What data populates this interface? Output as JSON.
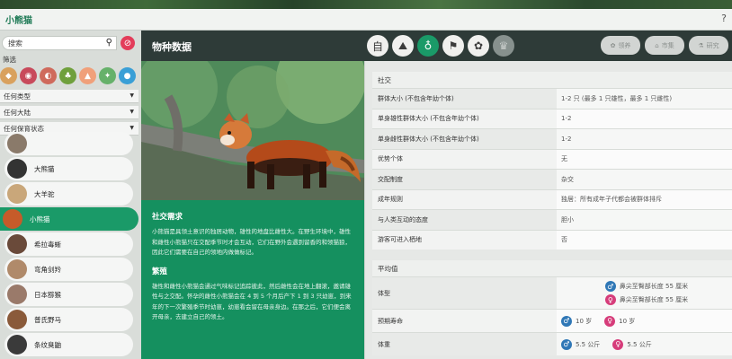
{
  "titlebar": {
    "title": "小熊猫",
    "help": "?"
  },
  "search": {
    "placeholder": "搜索",
    "search_icon": "search-icon",
    "clear_icon": "no-entry-icon"
  },
  "filter": {
    "label": "筛选",
    "icons": [
      {
        "name": "filter-continent-icon",
        "color": "#d9a15e"
      },
      {
        "name": "filter-habitat-icon",
        "color": "#c84a5b"
      },
      {
        "name": "filter-climate-icon",
        "color": "#cf6a5c"
      },
      {
        "name": "filter-forest-icon",
        "color": "#6fa03c"
      },
      {
        "name": "filter-mountain-icon",
        "color": "#f0a07a"
      },
      {
        "name": "filter-arctic-icon",
        "color": "#66b16a"
      },
      {
        "name": "filter-aquatic-icon",
        "color": "#3a9fd6"
      }
    ],
    "dropdowns": [
      "任何类型",
      "任何大陆",
      "任何保育状态"
    ]
  },
  "animals": [
    {
      "label": "",
      "color": "#8a7a6a"
    },
    {
      "label": "大熊猫",
      "color": "#333"
    },
    {
      "label": "大羊驼",
      "color": "#c9a77a"
    },
    {
      "label": "小熊猫",
      "color": "#c65b2a",
      "selected": true
    },
    {
      "label": "希拉毒蜥",
      "color": "#6a4a3a"
    },
    {
      "label": "弯角剑羚",
      "color": "#b08a6a"
    },
    {
      "label": "日本猕猴",
      "color": "#9a7a6a"
    },
    {
      "label": "普氏野马",
      "color": "#8a5a3a"
    },
    {
      "label": "条纹臭鼬",
      "color": "#3a3a3a"
    }
  ],
  "header": {
    "title": "物种数据"
  },
  "tabs": [
    {
      "name": "info-tab-icon",
      "glyph": "自"
    },
    {
      "name": "habitat-tab-icon",
      "glyph": "⛰"
    },
    {
      "name": "diet-tab-icon",
      "glyph": "♁",
      "active": true
    },
    {
      "name": "enrichment-tab-icon",
      "glyph": "⚑"
    },
    {
      "name": "paw-tab-icon",
      "glyph": "✿"
    },
    {
      "name": "trophy-tab-icon",
      "glyph": "♛",
      "disabled": true
    }
  ],
  "right_buttons": [
    {
      "name": "adopt-button",
      "icon": "✿",
      "label": "领养"
    },
    {
      "name": "market-button",
      "icon": "⌂",
      "label": "市集"
    },
    {
      "name": "research-button",
      "icon": "⚗",
      "label": "研究"
    }
  ],
  "info": {
    "social_title": "社交需求",
    "social_text": "小熊猫是具领土意识的独居动物，雄性的地盘比雌性大。在野生环境中，雄性和雌性小熊猫只在交配季节时才会互动，它们在野外会遇到留香的和领猫狼，因此它们需要在自己的领地内做做标记。",
    "breeding_title": "繁殖",
    "breeding_text": "雄性和雌性小熊猫会通过气味标记追踪彼此，然后雌性会在地上翻滚，邀请雄性与之交配。怀孕的雌性小熊猫会在 4 到 5 个月后产下 1 到 3 只幼崽，到来年的下一次繁殖季节时幼崽，幼崽看会留在母亲身边。在那之后，它们便会离开母亲，去建立自己的领土。"
  },
  "social": {
    "title": "社交",
    "rows": [
      {
        "k": "群体大小 (不包含年幼个体)",
        "v": "1-2 只 (最多 1 只雄性，最多 1 只雌性)"
      },
      {
        "k": "单身雄性群体大小 (不包含年幼个体)",
        "v": "1-2"
      },
      {
        "k": "单身雌性群体大小 (不包含年幼个体)",
        "v": "1-2"
      },
      {
        "k": "优势个体",
        "v": "无"
      },
      {
        "k": "交配制度",
        "v": "杂交"
      },
      {
        "k": "成年规则",
        "v": "独居：所有成年子代都会被群体排斥"
      },
      {
        "k": "与人类互动的态度",
        "v": "胆小"
      },
      {
        "k": "游客可进入栖地",
        "v": "否"
      }
    ]
  },
  "averages": {
    "title": "平均值",
    "body_label": "体型",
    "body_male": "鼻尖至臀部长度 55 厘米",
    "body_female": "鼻尖至臀部长度 55 厘米",
    "life_label": "预期寿命",
    "life_male": "10 岁",
    "life_female": "10 岁",
    "weight_label": "体重",
    "weight_male": "5.5 公斤",
    "weight_female": "5.5 公斤",
    "male_symbol": "♂",
    "female_symbol": "♀"
  }
}
